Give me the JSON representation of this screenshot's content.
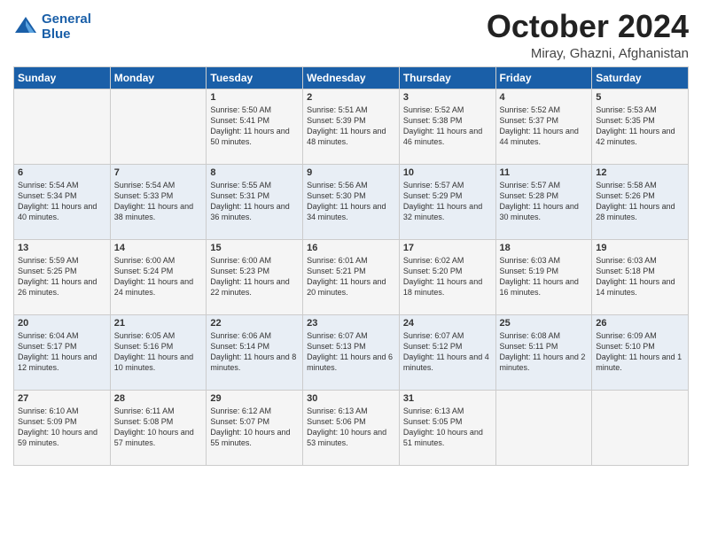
{
  "header": {
    "logo_line1": "General",
    "logo_line2": "Blue",
    "month": "October 2024",
    "location": "Miray, Ghazni, Afghanistan"
  },
  "weekdays": [
    "Sunday",
    "Monday",
    "Tuesday",
    "Wednesday",
    "Thursday",
    "Friday",
    "Saturday"
  ],
  "weeks": [
    [
      {
        "day": "",
        "content": ""
      },
      {
        "day": "",
        "content": ""
      },
      {
        "day": "1",
        "content": "Sunrise: 5:50 AM\nSunset: 5:41 PM\nDaylight: 11 hours and 50 minutes."
      },
      {
        "day": "2",
        "content": "Sunrise: 5:51 AM\nSunset: 5:39 PM\nDaylight: 11 hours and 48 minutes."
      },
      {
        "day": "3",
        "content": "Sunrise: 5:52 AM\nSunset: 5:38 PM\nDaylight: 11 hours and 46 minutes."
      },
      {
        "day": "4",
        "content": "Sunrise: 5:52 AM\nSunset: 5:37 PM\nDaylight: 11 hours and 44 minutes."
      },
      {
        "day": "5",
        "content": "Sunrise: 5:53 AM\nSunset: 5:35 PM\nDaylight: 11 hours and 42 minutes."
      }
    ],
    [
      {
        "day": "6",
        "content": "Sunrise: 5:54 AM\nSunset: 5:34 PM\nDaylight: 11 hours and 40 minutes."
      },
      {
        "day": "7",
        "content": "Sunrise: 5:54 AM\nSunset: 5:33 PM\nDaylight: 11 hours and 38 minutes."
      },
      {
        "day": "8",
        "content": "Sunrise: 5:55 AM\nSunset: 5:31 PM\nDaylight: 11 hours and 36 minutes."
      },
      {
        "day": "9",
        "content": "Sunrise: 5:56 AM\nSunset: 5:30 PM\nDaylight: 11 hours and 34 minutes."
      },
      {
        "day": "10",
        "content": "Sunrise: 5:57 AM\nSunset: 5:29 PM\nDaylight: 11 hours and 32 minutes."
      },
      {
        "day": "11",
        "content": "Sunrise: 5:57 AM\nSunset: 5:28 PM\nDaylight: 11 hours and 30 minutes."
      },
      {
        "day": "12",
        "content": "Sunrise: 5:58 AM\nSunset: 5:26 PM\nDaylight: 11 hours and 28 minutes."
      }
    ],
    [
      {
        "day": "13",
        "content": "Sunrise: 5:59 AM\nSunset: 5:25 PM\nDaylight: 11 hours and 26 minutes."
      },
      {
        "day": "14",
        "content": "Sunrise: 6:00 AM\nSunset: 5:24 PM\nDaylight: 11 hours and 24 minutes."
      },
      {
        "day": "15",
        "content": "Sunrise: 6:00 AM\nSunset: 5:23 PM\nDaylight: 11 hours and 22 minutes."
      },
      {
        "day": "16",
        "content": "Sunrise: 6:01 AM\nSunset: 5:21 PM\nDaylight: 11 hours and 20 minutes."
      },
      {
        "day": "17",
        "content": "Sunrise: 6:02 AM\nSunset: 5:20 PM\nDaylight: 11 hours and 18 minutes."
      },
      {
        "day": "18",
        "content": "Sunrise: 6:03 AM\nSunset: 5:19 PM\nDaylight: 11 hours and 16 minutes."
      },
      {
        "day": "19",
        "content": "Sunrise: 6:03 AM\nSunset: 5:18 PM\nDaylight: 11 hours and 14 minutes."
      }
    ],
    [
      {
        "day": "20",
        "content": "Sunrise: 6:04 AM\nSunset: 5:17 PM\nDaylight: 11 hours and 12 minutes."
      },
      {
        "day": "21",
        "content": "Sunrise: 6:05 AM\nSunset: 5:16 PM\nDaylight: 11 hours and 10 minutes."
      },
      {
        "day": "22",
        "content": "Sunrise: 6:06 AM\nSunset: 5:14 PM\nDaylight: 11 hours and 8 minutes."
      },
      {
        "day": "23",
        "content": "Sunrise: 6:07 AM\nSunset: 5:13 PM\nDaylight: 11 hours and 6 minutes."
      },
      {
        "day": "24",
        "content": "Sunrise: 6:07 AM\nSunset: 5:12 PM\nDaylight: 11 hours and 4 minutes."
      },
      {
        "day": "25",
        "content": "Sunrise: 6:08 AM\nSunset: 5:11 PM\nDaylight: 11 hours and 2 minutes."
      },
      {
        "day": "26",
        "content": "Sunrise: 6:09 AM\nSunset: 5:10 PM\nDaylight: 11 hours and 1 minute."
      }
    ],
    [
      {
        "day": "27",
        "content": "Sunrise: 6:10 AM\nSunset: 5:09 PM\nDaylight: 10 hours and 59 minutes."
      },
      {
        "day": "28",
        "content": "Sunrise: 6:11 AM\nSunset: 5:08 PM\nDaylight: 10 hours and 57 minutes."
      },
      {
        "day": "29",
        "content": "Sunrise: 6:12 AM\nSunset: 5:07 PM\nDaylight: 10 hours and 55 minutes."
      },
      {
        "day": "30",
        "content": "Sunrise: 6:13 AM\nSunset: 5:06 PM\nDaylight: 10 hours and 53 minutes."
      },
      {
        "day": "31",
        "content": "Sunrise: 6:13 AM\nSunset: 5:05 PM\nDaylight: 10 hours and 51 minutes."
      },
      {
        "day": "",
        "content": ""
      },
      {
        "day": "",
        "content": ""
      }
    ]
  ]
}
